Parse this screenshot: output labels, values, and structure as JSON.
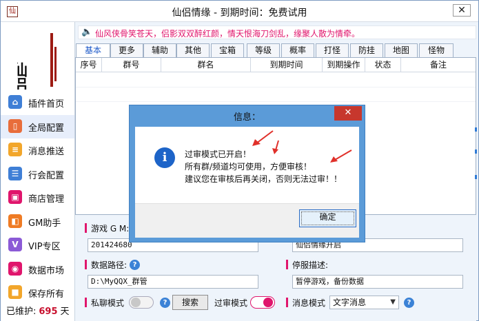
{
  "window": {
    "title": "仙侣情缘 - 到期时间：免费试用",
    "close_glyph": "✕"
  },
  "logo": {
    "text": "仙侣情缘"
  },
  "sidebar": {
    "items": [
      {
        "label": "插件首页",
        "icon_color": "#3f7fd6"
      },
      {
        "label": "全局配置",
        "icon_color": "#e86d3b"
      },
      {
        "label": "消息推送",
        "icon_color": "#f2a62b"
      },
      {
        "label": "行会配置",
        "icon_color": "#3f7fd6"
      },
      {
        "label": "商店管理",
        "icon_color": "#e0156c"
      },
      {
        "label": "GM助手",
        "icon_color": "#ef7b24"
      },
      {
        "label": "VIP专区",
        "icon_color": "#8b5ad6"
      },
      {
        "label": "数据市场",
        "icon_color": "#e0156c"
      },
      {
        "label": "保存所有",
        "icon_color": "#f2a62b"
      }
    ],
    "maintenance_label": "已维护:",
    "maintenance_days": "695",
    "maintenance_unit": "天"
  },
  "ticker": {
    "text": "仙风侠骨笑苍天，侣影双双醉红颜，情天恨海刀剑乱，缘聚人散为情牵。"
  },
  "tabs": [
    "基本",
    "更多",
    "辅助",
    "其他",
    "宝箱",
    "等级",
    "概率",
    "打怪",
    "防挂",
    "地图",
    "怪物"
  ],
  "table": {
    "columns": [
      "序号",
      "群号",
      "群名",
      "到期时间",
      "到期操作",
      "状态",
      "备注"
    ]
  },
  "form": {
    "gm_label": "游戏 G M:",
    "gm_value": "201424680",
    "right_top_value": "仙侣情缘开启",
    "data_path_label": "数据路径:",
    "data_path_value": "D:\\MyQQX_群管",
    "stop_desc_label": "停服描述:",
    "stop_desc_value": "暂停游戏，备份数据",
    "private_chat_label": "私聊模式",
    "search_button": "搜索",
    "audit_mode_label": "过审模式",
    "message_mode_label": "消息模式",
    "message_mode_value": "文字消息"
  },
  "dialog": {
    "title": "信息：",
    "close_glyph": "✕",
    "line1": "过审模式已开启！",
    "line2": "所有群/频道均可使用，方便审核！",
    "line3": "建议您在审核后再关闭，否则无法过审！！",
    "ok_button": "确定",
    "arrow_color": "#e0302a"
  },
  "icons": {
    "speaker": "speaker-icon",
    "info": "info-icon",
    "help": "help-icon"
  }
}
